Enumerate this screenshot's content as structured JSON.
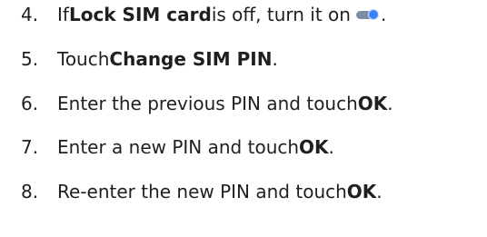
{
  "steps": [
    {
      "number": "4.",
      "segments": [
        {
          "text": "If "
        },
        {
          "text": "Lock SIM card",
          "bold": true
        },
        {
          "text": " is off, turn it on "
        },
        {
          "icon": "toggle-switch-icon"
        },
        {
          "text": "."
        }
      ]
    },
    {
      "number": "5.",
      "segments": [
        {
          "text": "Touch "
        },
        {
          "text": "Change SIM PIN",
          "bold": true
        },
        {
          "text": "."
        }
      ]
    },
    {
      "number": "6.",
      "segments": [
        {
          "text": "Enter the previous PIN and touch "
        },
        {
          "text": "OK",
          "bold": true
        },
        {
          "text": "."
        }
      ]
    },
    {
      "number": "7.",
      "segments": [
        {
          "text": "Enter a new PIN and touch "
        },
        {
          "text": "OK",
          "bold": true
        },
        {
          "text": "."
        }
      ]
    },
    {
      "number": "8.",
      "segments": [
        {
          "text": "Re-enter the new PIN and touch "
        },
        {
          "text": "OK",
          "bold": true
        },
        {
          "text": "."
        }
      ]
    }
  ],
  "colors": {
    "text": "#1f1f1f",
    "toggle_track": "#7a8fa6",
    "toggle_knob": "#3b82f6"
  }
}
